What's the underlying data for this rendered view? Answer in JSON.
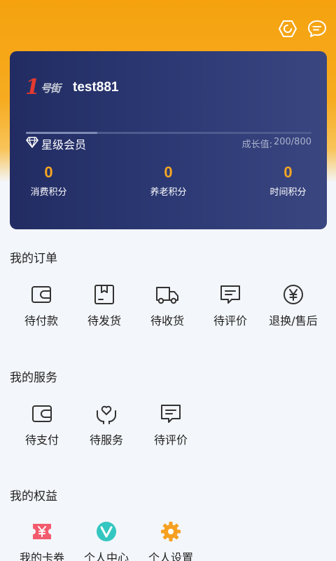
{
  "header": {
    "icons": [
      "scan-icon",
      "message-icon"
    ]
  },
  "member": {
    "logo_one": "1",
    "logo_text": "号街",
    "username": "test881",
    "level_name": "星级会员",
    "growth_label": "成长值:",
    "growth_value": "200/800",
    "growth_progress": 0.25,
    "points": [
      {
        "value": "0",
        "label": "消费积分"
      },
      {
        "value": "0",
        "label": "养老积分"
      },
      {
        "value": "0",
        "label": "时间积分"
      }
    ]
  },
  "orders": {
    "title": "我的订单",
    "items": [
      {
        "label": "待付款",
        "icon": "wallet-icon"
      },
      {
        "label": "待发货",
        "icon": "package-icon"
      },
      {
        "label": "待收货",
        "icon": "truck-icon"
      },
      {
        "label": "待评价",
        "icon": "comment-icon"
      },
      {
        "label": "退换/售后",
        "icon": "yen-circle-icon"
      }
    ]
  },
  "services": {
    "title": "我的服务",
    "items": [
      {
        "label": "待支付",
        "icon": "wallet-icon"
      },
      {
        "label": "待服务",
        "icon": "heart-hand-icon"
      },
      {
        "label": "待评价",
        "icon": "comment-icon"
      }
    ]
  },
  "rights": {
    "title": "我的权益",
    "items": [
      {
        "label": "我的卡券",
        "icon": "coupon-icon",
        "color": "#f25b6e"
      },
      {
        "label": "个人中心",
        "icon": "v-circle-icon",
        "color": "#34c6c0"
      },
      {
        "label": "个人设置",
        "icon": "gear-icon",
        "color": "#f5a020"
      }
    ]
  },
  "colors": {
    "header_orange": "#f5a20e",
    "card_navy": "#222c63",
    "points_orange": "#f5a623"
  }
}
